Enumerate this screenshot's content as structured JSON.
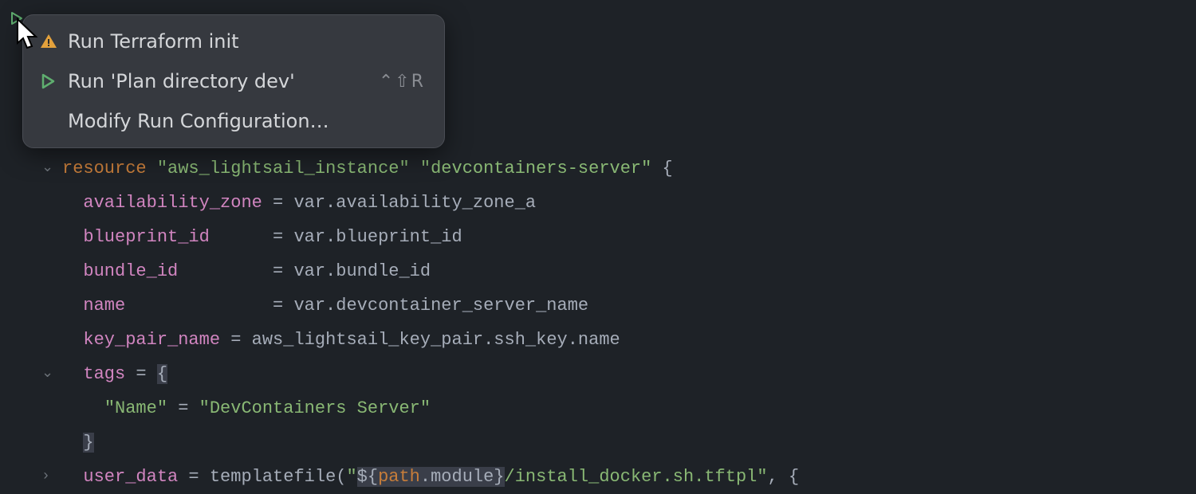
{
  "menu": {
    "items": [
      {
        "icon": "warning",
        "label": "Run Terraform init",
        "shortcut": ""
      },
      {
        "icon": "play",
        "label": "Run 'Plan directory dev'",
        "shortcut": "⌃⇧R"
      },
      {
        "icon": "",
        "label": "Modify Run Configuration…",
        "shortcut": ""
      }
    ]
  },
  "code": {
    "lines": [
      {
        "fold": "down",
        "tokens": [
          {
            "t": "resource ",
            "c": "keyword"
          },
          {
            "t": "\"aws_lightsail_instance\" \"devcontainers-server\" ",
            "c": "str"
          },
          {
            "t": "{",
            "c": "punct"
          }
        ]
      },
      {
        "tokens": [
          {
            "t": "  ",
            "c": ""
          },
          {
            "t": "availability_zone",
            "c": "prop"
          },
          {
            "t": " = var.availability_zone_a",
            "c": "punct"
          }
        ]
      },
      {
        "tokens": [
          {
            "t": "  ",
            "c": ""
          },
          {
            "t": "blueprint_id",
            "c": "prop"
          },
          {
            "t": "      = var.blueprint_id",
            "c": "punct"
          }
        ]
      },
      {
        "tokens": [
          {
            "t": "  ",
            "c": ""
          },
          {
            "t": "bundle_id",
            "c": "prop"
          },
          {
            "t": "         = var.bundle_id",
            "c": "punct"
          }
        ]
      },
      {
        "tokens": [
          {
            "t": "  ",
            "c": ""
          },
          {
            "t": "name",
            "c": "prop"
          },
          {
            "t": "              = var.devcontainer_server_name",
            "c": "punct"
          }
        ]
      },
      {
        "tokens": [
          {
            "t": "  ",
            "c": ""
          },
          {
            "t": "key_pair_name",
            "c": "prop"
          },
          {
            "t": " = aws_lightsail_key_pair.ssh_key.name",
            "c": "punct"
          }
        ]
      },
      {
        "fold": "down",
        "tokens": [
          {
            "t": "  ",
            "c": ""
          },
          {
            "t": "tags",
            "c": "prop"
          },
          {
            "t": " = ",
            "c": "punct"
          },
          {
            "t": "{",
            "c": "punct",
            "hl": true
          }
        ]
      },
      {
        "guide": true,
        "tokens": [
          {
            "t": "    ",
            "c": ""
          },
          {
            "t": "\"Name\"",
            "c": "str"
          },
          {
            "t": " = ",
            "c": "punct"
          },
          {
            "t": "\"DevContainers Server\"",
            "c": "str"
          }
        ]
      },
      {
        "guide": true,
        "tokens": [
          {
            "t": "  ",
            "c": ""
          },
          {
            "t": "}",
            "c": "punct",
            "hl": true
          }
        ]
      },
      {
        "fold": "right",
        "tokens": [
          {
            "t": "  ",
            "c": ""
          },
          {
            "t": "user_data",
            "c": "prop"
          },
          {
            "t": " = templatefile(",
            "c": "punct"
          },
          {
            "t": "\"",
            "c": "str"
          },
          {
            "t": "${",
            "c": "punct",
            "pathhl": true
          },
          {
            "t": "path",
            "c": "keyword",
            "pathhl": true
          },
          {
            "t": ".module}",
            "c": "punct",
            "pathhl": true
          },
          {
            "t": "/install_docker.sh.tftpl\"",
            "c": "str"
          },
          {
            "t": ", {",
            "c": "punct"
          }
        ]
      }
    ]
  }
}
